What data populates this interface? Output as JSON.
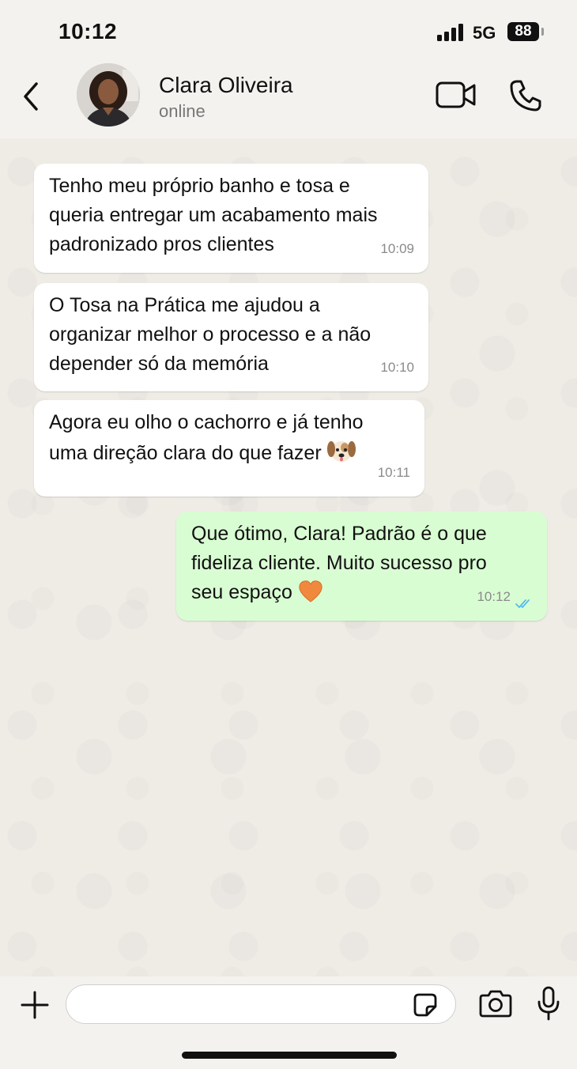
{
  "status_bar": {
    "time": "10:12",
    "network": "5G",
    "battery": "88"
  },
  "header": {
    "contact_name": "Clara Oliveira",
    "contact_status": "online",
    "icons": {
      "back": "chevron-left-icon",
      "video": "video-camera-icon",
      "call": "phone-icon"
    }
  },
  "messages": [
    {
      "direction": "in",
      "text": "Tenho meu próprio banho e tosa e\nqueria entregar um acabamento mais\npadronizado pros clientes",
      "time": "10:09"
    },
    {
      "direction": "in",
      "text": "O Tosa na Prática me ajudou a\norganizar melhor o processo e a não\ndepender só da memória",
      "time": "10:10"
    },
    {
      "direction": "in",
      "text": "Agora eu olho o cachorro e já tenho\numa direção clara do que fazer",
      "emoji": "dog-face-emoji",
      "time": "10:11"
    },
    {
      "direction": "out",
      "text": "Que ótimo, Clara! Padrão é o que\nfideliza cliente. Muito sucesso pro\nseu espaço",
      "emoji": "orange-heart-emoji",
      "time": "10:12",
      "status": "read"
    }
  ],
  "input_bar": {
    "placeholder": "",
    "icons": {
      "attach": "plus-icon",
      "sticker": "sticker-icon",
      "camera": "camera-icon",
      "mic": "microphone-icon"
    }
  },
  "colors": {
    "incoming_bubble": "#ffffff",
    "outgoing_bubble": "#d9fdd3",
    "read_ticks": "#53bdeb",
    "chat_background": "#efebe5"
  }
}
